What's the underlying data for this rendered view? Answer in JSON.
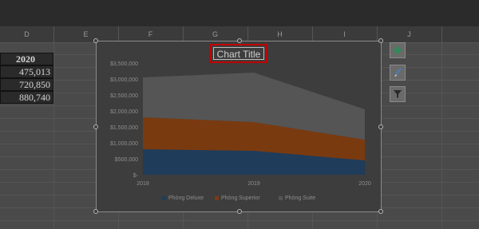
{
  "column_headers": [
    "D",
    "E",
    "F",
    "G",
    "H",
    "I",
    "J"
  ],
  "data_column": {
    "header": "2020",
    "values": [
      "475,013",
      "720,850",
      "880,740"
    ]
  },
  "chart_data": {
    "type": "area",
    "title": "Chart Title",
    "categories": [
      "2018",
      "2019",
      "2020"
    ],
    "series": [
      {
        "name": "Phòng Deluxe",
        "values": [
          800000,
          750000,
          450000
        ]
      },
      {
        "name": "Phòng Superior",
        "values": [
          1000000,
          900000,
          650000
        ]
      },
      {
        "name": "Phòng Suite",
        "values": [
          1250000,
          1550000,
          950000
        ]
      }
    ],
    "y_ticks": [
      "$-",
      "$500,000",
      "$1,000,000",
      "$1,500,000",
      "$2,000,000",
      "$2,500,000",
      "$3,000,000",
      "$3,500,000"
    ],
    "ylim": [
      0,
      3500000
    ],
    "stacked": true,
    "grid": false,
    "legend_position": "bottom",
    "colors": {
      "deluxe": "#1f3c5a",
      "superior": "#7a3a10",
      "suite": "#555555"
    }
  },
  "side_buttons": {
    "add": "plus-icon",
    "style": "brush-icon",
    "filter": "filter-icon"
  }
}
